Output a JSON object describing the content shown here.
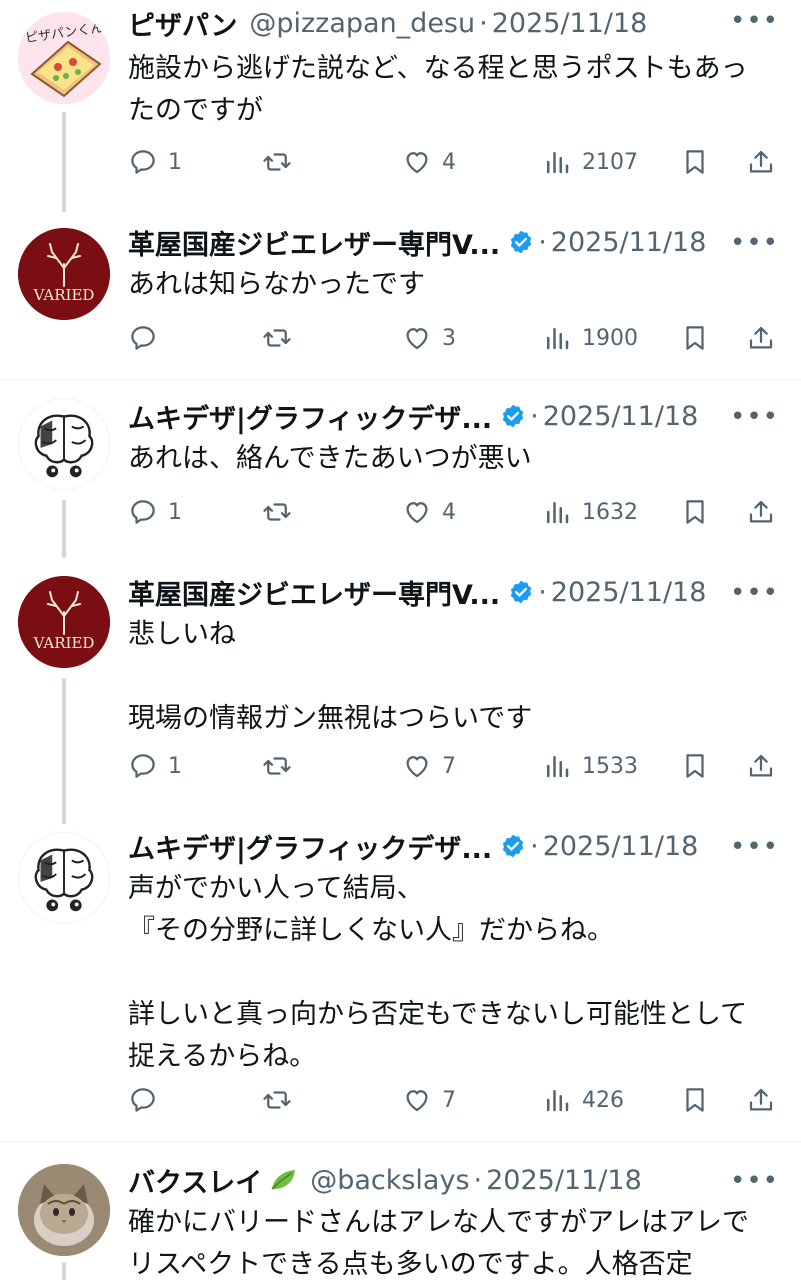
{
  "tweets": [
    {
      "name": "ピザパン",
      "handle": "@pizzapan_desu",
      "date": "2025/11/18",
      "body": "施設から逃げた説など、なる程と思うポストもあったのですが",
      "replies": "1",
      "retweets": "",
      "likes": "4",
      "views": "2107",
      "avatar": "pizza-toast-avatar",
      "avatar_text": "ピザパンくん",
      "verified": false
    },
    {
      "name": "革屋国産ジビエレザー専門V...",
      "handle": "",
      "date": "2025/11/18",
      "body": "あれは知らなかったです",
      "replies": "",
      "retweets": "",
      "likes": "3",
      "views": "1900",
      "avatar": "varied-deer-logo",
      "avatar_text": "VARIED",
      "verified": true
    },
    {
      "name": "ムキデザ|グラフィックデザ...",
      "handle": "",
      "date": "2025/11/18",
      "body": "あれは、絡んできたあいつが悪い",
      "replies": "1",
      "retweets": "",
      "likes": "4",
      "views": "1632",
      "avatar": "brain-character",
      "verified": true
    },
    {
      "name": "革屋国産ジビエレザー専門V...",
      "handle": "",
      "date": "2025/11/18",
      "body": "悲しいね\n\n現場の情報ガン無視はつらいです",
      "replies": "1",
      "retweets": "",
      "likes": "7",
      "views": "1533",
      "avatar": "varied-deer-logo",
      "avatar_text": "VARIED",
      "verified": true
    },
    {
      "name": "ムキデザ|グラフィックデザ...",
      "handle": "",
      "date": "2025/11/18",
      "body": "声がでかい人って結局、\n『その分野に詳しくない人』だからね。\n\n詳しいと真っ向から否定もできないし可能性として捉えるからね。",
      "replies": "",
      "retweets": "",
      "likes": "7",
      "views": "426",
      "avatar": "brain-character",
      "verified": true
    },
    {
      "name": "バクスレイ",
      "handle": "@backslays",
      "date": "2025/11/18",
      "body": "確かにバリードさんはアレな人ですがアレはアレでリスペクトできる点も多いのですよ。人格否定",
      "replies": "",
      "retweets": "",
      "likes": "",
      "views": "",
      "avatar": "cat-photo",
      "verified": false
    }
  ],
  "icons": {
    "more": "more-icon",
    "reply": "reply-icon",
    "retweet": "retweet-icon",
    "like": "like-icon",
    "views": "views-icon",
    "bookmark": "bookmark-icon",
    "share": "share-icon",
    "verified": "verified-badge-icon",
    "leaf": "leaf-emoji-icon"
  },
  "colors": {
    "verified": "#1d9bf0",
    "secondary_text": "#536471",
    "thread_line": "#cfd9de",
    "varied_red": "#7a0e12"
  }
}
